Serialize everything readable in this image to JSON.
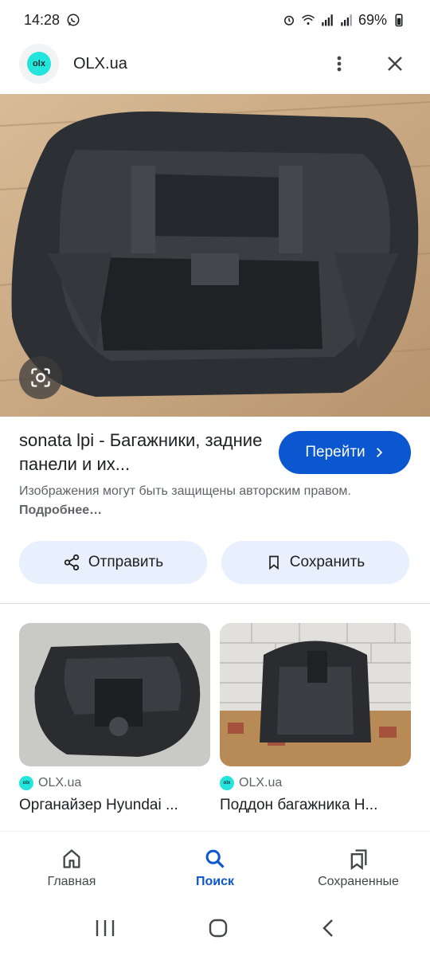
{
  "status_bar": {
    "time": "14:28",
    "battery": "69%"
  },
  "header": {
    "site_name": "OLX.ua",
    "logo_text": "olx"
  },
  "result": {
    "title": "sonata lpi - Багажники, задние панели и их...",
    "visit_label": "Перейти",
    "copyright_text": "Изображения могут быть защищены авторским правом.",
    "more_link": "Подробнее…"
  },
  "actions": {
    "share_label": "Отправить",
    "save_label": "Сохранить"
  },
  "related": [
    {
      "source": "OLX.ua",
      "title": "Органайзер Hyundai ..."
    },
    {
      "source": "OLX.ua",
      "title": "Поддон багажника H..."
    }
  ],
  "bottom_nav": [
    {
      "label": "Главная",
      "icon": "home-icon",
      "active": false
    },
    {
      "label": "Поиск",
      "icon": "search-icon",
      "active": true
    },
    {
      "label": "Сохраненные",
      "icon": "saved-icon",
      "active": false
    }
  ],
  "colors": {
    "accent": "#0b57d0",
    "pill_bg": "#e8f0fe",
    "olx_teal": "#23e5db"
  }
}
